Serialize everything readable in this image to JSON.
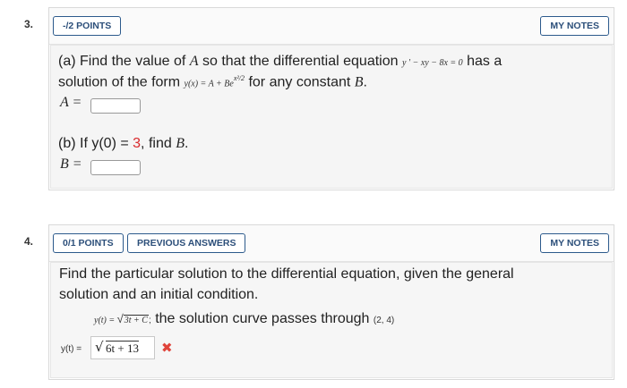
{
  "q3": {
    "number": "3.",
    "points_label": "-/2 POINTS",
    "my_notes_label": "MY NOTES",
    "part_a": {
      "intro": "(a) Find the value of ",
      "var_a": "A",
      "mid": " so that the differential equation ",
      "equation": "y ′ − xy − 8x = 0",
      "after": " has a",
      "line2_start": "solution of the form ",
      "form": "y(x) = A + Be",
      "exponent": "x²/2",
      "line2_end": " for any constant ",
      "var_b": "B",
      "period": ".",
      "answer_label": "A ="
    },
    "part_b": {
      "intro": "(b) If ",
      "cond": "y(0) = ",
      "value": "3",
      "end": ", find ",
      "var_b": "B",
      "period": ".",
      "answer_label": "B ="
    }
  },
  "q4": {
    "number": "4.",
    "points_label": "0/1 POINTS",
    "previous_answers_label": "PREVIOUS ANSWERS",
    "my_notes_label": "MY NOTES",
    "line1": "Find the particular solution to the differential equation, given the general",
    "line2": "solution and an initial condition.",
    "general_lhs": "y(t) = ",
    "general_rad": "3t + C",
    "general_semicolon": ";",
    "curve_text": " the solution curve passes through ",
    "point": "(2, 4)",
    "answer_label": "y(t) =",
    "answer_rad": "6t + 13",
    "mark": "✖",
    "accent_red": "#e0443b"
  }
}
